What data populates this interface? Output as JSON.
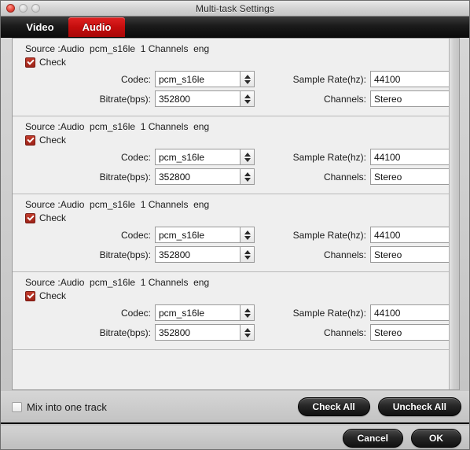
{
  "window": {
    "title": "Multi-task Settings",
    "traffic_lights": [
      "close",
      "minimize",
      "maximize"
    ]
  },
  "tabs": [
    {
      "label": "Video",
      "active": false
    },
    {
      "label": "Audio",
      "active": true
    }
  ],
  "labels": {
    "check": "Check",
    "codec": "Codec:",
    "bitrate": "Bitrate(bps):",
    "sample_rate": "Sample Rate(hz):",
    "channels": "Channels:"
  },
  "audio_tracks": [
    {
      "source": "Source :Audio  pcm_s16le  1 Channels  eng",
      "checked": true,
      "codec": "pcm_s16le",
      "bitrate": "352800",
      "sample_rate": "44100",
      "channels": "Stereo"
    },
    {
      "source": "Source :Audio  pcm_s16le  1 Channels  eng",
      "checked": true,
      "codec": "pcm_s16le",
      "bitrate": "352800",
      "sample_rate": "44100",
      "channels": "Stereo"
    },
    {
      "source": "Source :Audio  pcm_s16le  1 Channels  eng",
      "checked": true,
      "codec": "pcm_s16le",
      "bitrate": "352800",
      "sample_rate": "44100",
      "channels": "Stereo"
    },
    {
      "source": "Source :Audio  pcm_s16le  1 Channels  eng",
      "checked": true,
      "codec": "pcm_s16le",
      "bitrate": "352800",
      "sample_rate": "44100",
      "channels": "Stereo"
    }
  ],
  "toolbar": {
    "mix_label": "Mix into one track",
    "mix_checked": false,
    "check_all_label": "Check All",
    "uncheck_all_label": "Uncheck All"
  },
  "footer": {
    "cancel_label": "Cancel",
    "ok_label": "OK"
  },
  "colors": {
    "accent_red": "#c40d0d",
    "checkbox_red": "#9d2318",
    "tabbar_black": "#0b0b0b",
    "panel_bg": "#efefef"
  }
}
